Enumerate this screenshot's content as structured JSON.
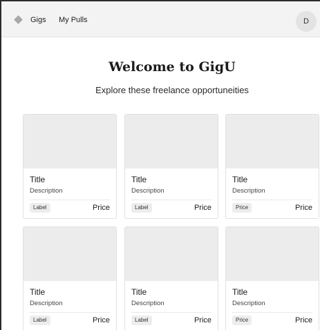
{
  "nav": {
    "logo_icon": "diamond-logo-icon",
    "links": [
      "Gigs",
      "My Pulls"
    ],
    "avatar_initial": "D"
  },
  "hero": {
    "title": "Welcome to GigU",
    "subtitle": "Explore these freelance opportuneities"
  },
  "cards": [
    {
      "title": "Title",
      "description": "Description",
      "badge": "Label",
      "price": "Price"
    },
    {
      "title": "Title",
      "description": "Description",
      "badge": "Label",
      "price": "Price"
    },
    {
      "title": "Title",
      "description": "Description",
      "badge": "Price",
      "price": "Price"
    },
    {
      "title": "Title",
      "description": "Description",
      "badge": "Label",
      "price": "Price"
    },
    {
      "title": "Title",
      "description": "Description",
      "badge": "Label",
      "price": "Price"
    },
    {
      "title": "Title",
      "description": "Description",
      "badge": "Price",
      "price": "Price"
    }
  ],
  "colors": {
    "topbar_bg": "#f3f3f3",
    "image_placeholder": "#ececec",
    "badge_bg": "#ededed"
  }
}
